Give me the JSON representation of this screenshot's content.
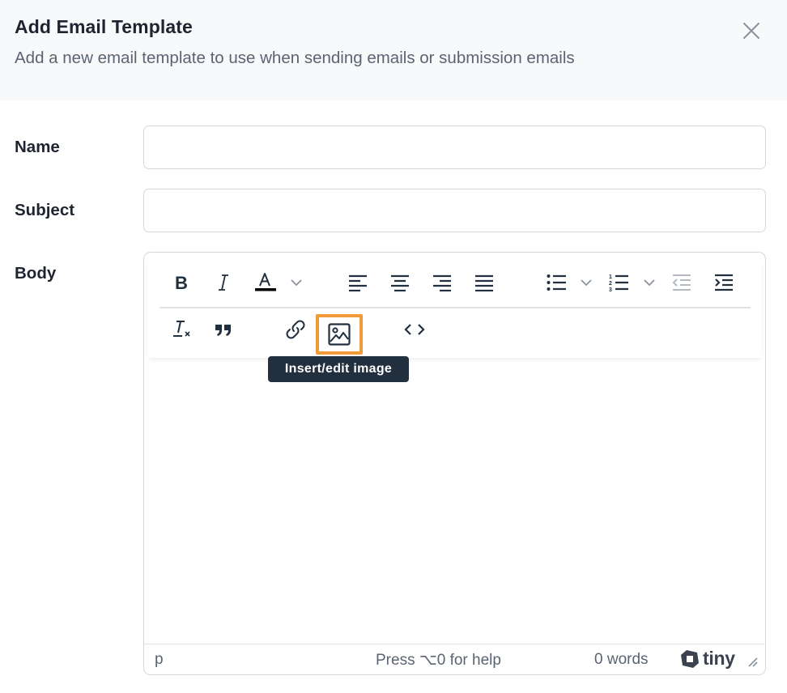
{
  "dialog": {
    "title": "Add Email Template",
    "subtitle": "Add a new email template to use when sending emails or submission emails"
  },
  "form": {
    "name_label": "Name",
    "name_value": "",
    "subject_label": "Subject",
    "subject_value": "",
    "body_label": "Body"
  },
  "toolbar": {
    "row1": [
      "bold-icon",
      "italic-icon",
      "text-color-icon",
      "align-left-icon",
      "align-center-icon",
      "align-right-icon",
      "align-justify-icon",
      "bullet-list-icon",
      "numbered-list-icon",
      "outdent-icon",
      "indent-icon"
    ],
    "row2": [
      "clear-formatting-icon",
      "blockquote-icon",
      "link-icon",
      "image-icon",
      "code-icon"
    ],
    "highlight_color": "#f09a3b"
  },
  "tooltip": {
    "text": "Insert/edit image"
  },
  "statusbar": {
    "path": "p",
    "help": "Press ⌥0 for help",
    "word_count": "0 words",
    "brand": "tiny"
  },
  "colors": {
    "header_bg": "#f7f9fb",
    "tooltip_bg": "#222f3e",
    "text_color_underline": "#000000"
  }
}
